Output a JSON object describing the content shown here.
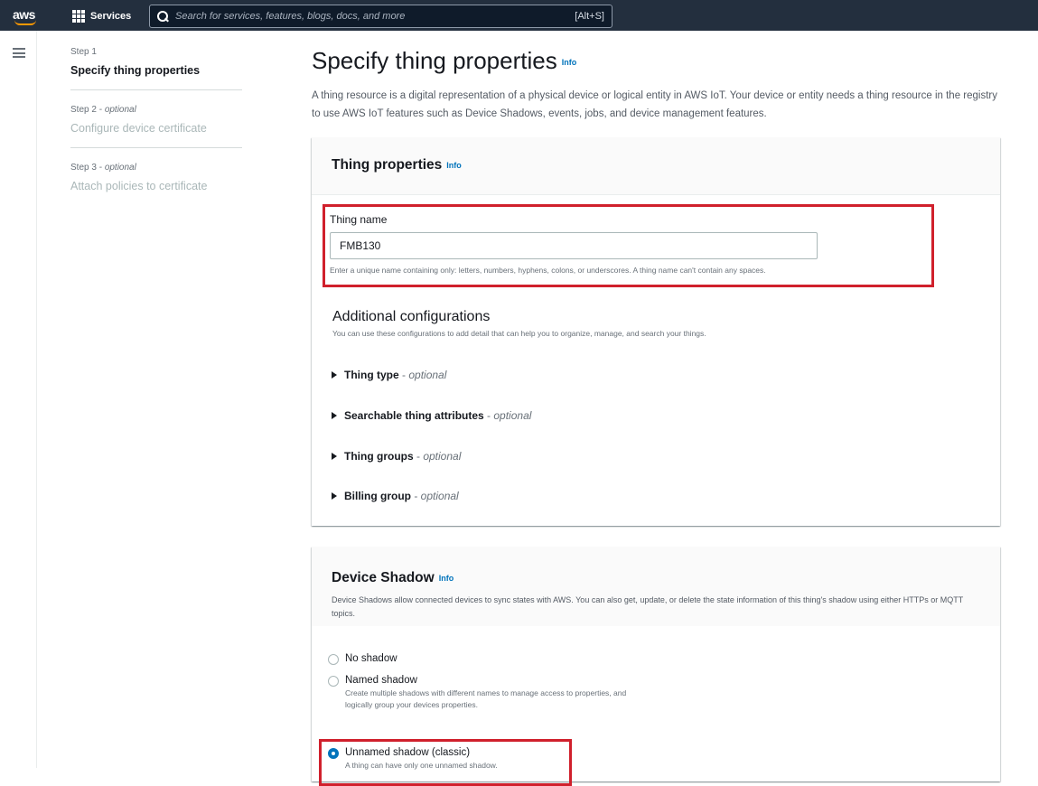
{
  "topbar": {
    "logo": "aws",
    "services_label": "Services",
    "search_placeholder": "Search for services, features, blogs, docs, and more",
    "search_shortcut": "[Alt+S]"
  },
  "steps": [
    {
      "label": "Step 1",
      "optional": "",
      "title": "Specify thing properties",
      "state": "active"
    },
    {
      "label": "Step 2 - ",
      "optional": "optional",
      "title": "Configure device certificate",
      "state": "inactive"
    },
    {
      "label": "Step 3 - ",
      "optional": "optional",
      "title": "Attach policies to certificate",
      "state": "inactive"
    }
  ],
  "main": {
    "title": "Specify thing properties",
    "info": "Info",
    "description": "A thing resource is a digital representation of a physical device or logical entity in AWS IoT. Your device or entity needs a thing resource in the registry to use AWS IoT features such as Device Shadows, events, jobs, and device management features."
  },
  "thing_properties": {
    "title": "Thing properties",
    "info": "Info",
    "name_label": "Thing name",
    "name_value": "FMB130",
    "name_hint": "Enter a unique name containing only: letters, numbers, hyphens, colons, or underscores. A thing name can't contain any spaces.",
    "additional_title": "Additional configurations",
    "additional_desc": "You can use these configurations to add detail that can help you to organize, manage, and search your things.",
    "expanders": [
      {
        "label": "Thing type",
        "suffix": " - ",
        "optional": "optional"
      },
      {
        "label": "Searchable thing attributes",
        "suffix": " - ",
        "optional": "optional"
      },
      {
        "label": "Thing groups",
        "suffix": " - ",
        "optional": "optional"
      },
      {
        "label": "Billing group",
        "suffix": " - ",
        "optional": "optional"
      }
    ]
  },
  "device_shadow": {
    "title": "Device Shadow",
    "info": "Info",
    "description": "Device Shadows allow connected devices to sync states with AWS. You can also get, update, or delete the state information of this thing's shadow using either HTTPs or MQTT topics.",
    "options": [
      {
        "label": "No shadow",
        "desc": "",
        "checked": false
      },
      {
        "label": "Named shadow",
        "desc": "Create multiple shadows with different names to manage access to properties, and logically group your devices properties.",
        "checked": false
      },
      {
        "label": "Unnamed shadow (classic)",
        "desc": "A thing can have only one unnamed shadow.",
        "checked": true
      }
    ]
  },
  "colors": {
    "nav_bg": "#232f3e",
    "accent": "#0073bb",
    "highlight": "#d0202c",
    "brand_orange": "#ff9900"
  }
}
